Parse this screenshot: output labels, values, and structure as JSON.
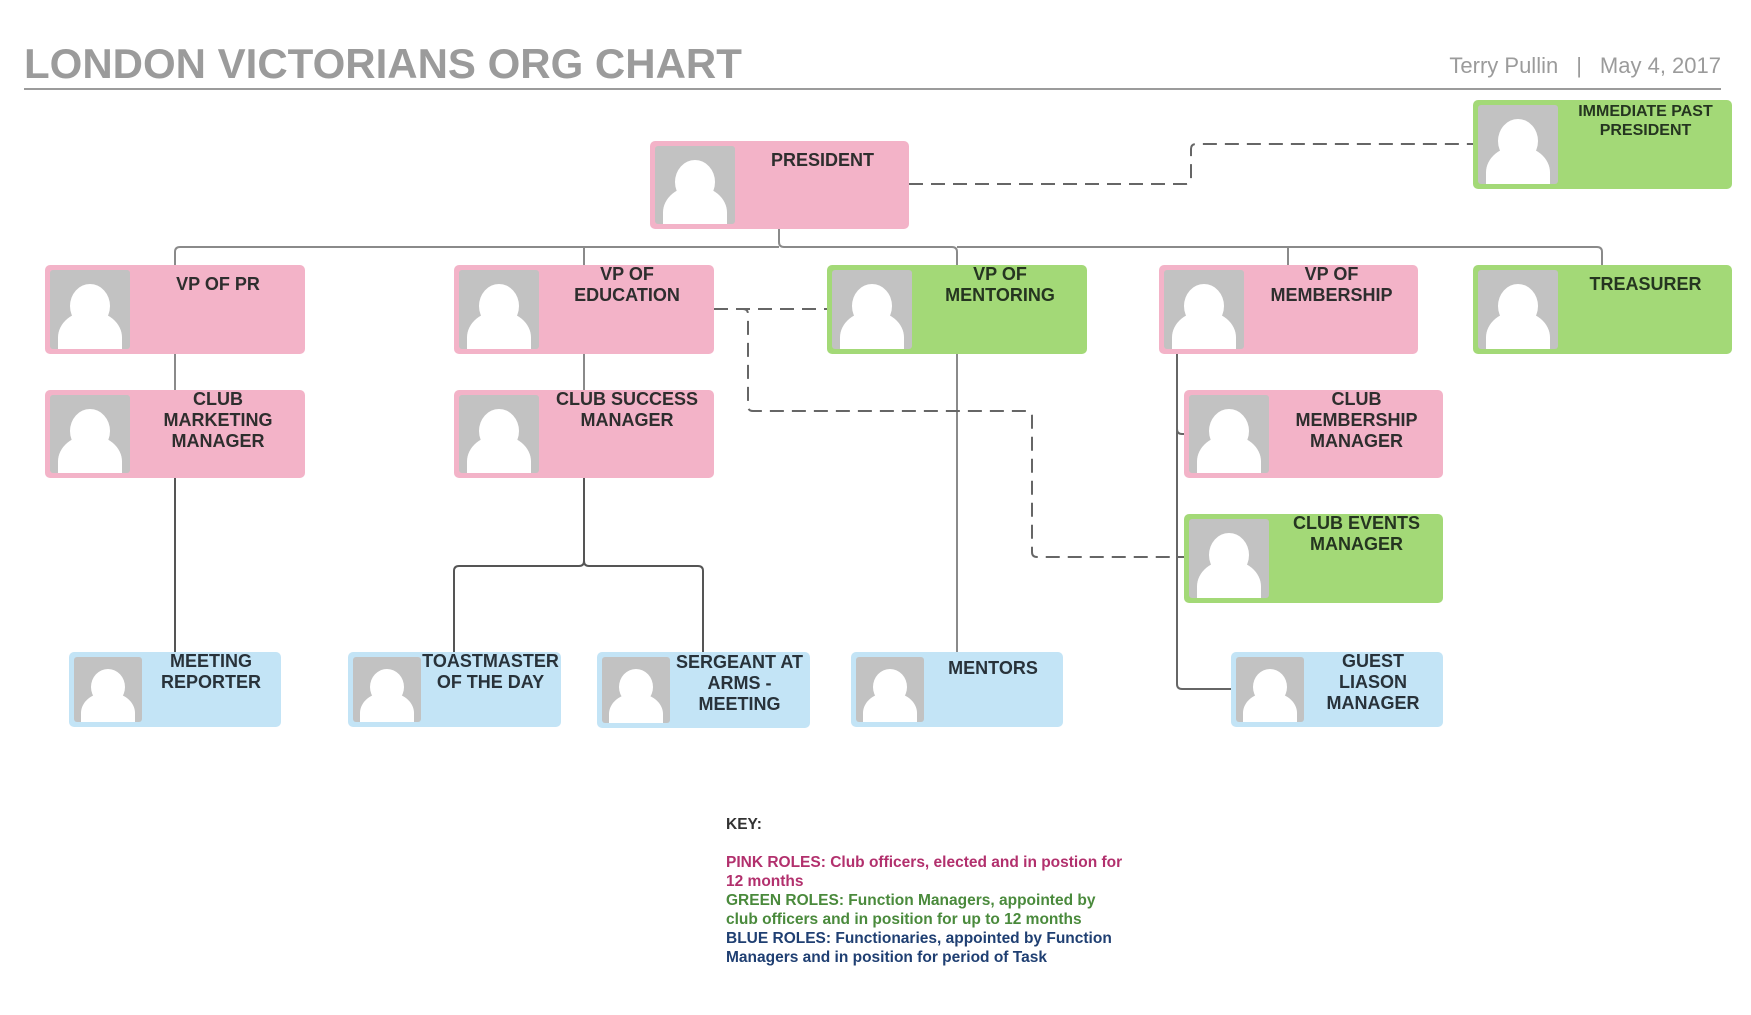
{
  "header": {
    "title": "LONDON VICTORIANS ORG CHART",
    "author": "Terry Pullin",
    "separator": "|",
    "date": "May 4, 2017"
  },
  "colors": {
    "pink": "#f3b3c8",
    "green": "#a3d977",
    "blue": "#c3e4f6",
    "photo_placeholder": "#c2c2c2",
    "connector": "#7a7a7a",
    "key_pink": "#b2306d",
    "key_green": "#4a8a3c",
    "key_blue": "#1f3f72"
  },
  "nodes": {
    "president": {
      "label": "PRESIDENT",
      "role_type": "pink",
      "icon": "person-placeholder-icon"
    },
    "immediate_past_president": {
      "label": "IMMEDIATE PAST\nPRESIDENT",
      "role_type": "green",
      "icon": "person-placeholder-icon"
    },
    "vp_pr": {
      "label": "VP OF PR",
      "role_type": "pink",
      "icon": "person-placeholder-icon"
    },
    "vp_education": {
      "label": "VP OF\nEDUCATION",
      "role_type": "pink",
      "icon": "person-placeholder-icon"
    },
    "vp_mentoring": {
      "label": "VP OF\nMENTORING",
      "role_type": "green",
      "icon": "person-placeholder-icon"
    },
    "vp_membership": {
      "label": "VP OF\nMEMBERSHIP",
      "role_type": "pink",
      "icon": "person-placeholder-icon"
    },
    "treasurer": {
      "label": "TREASURER",
      "role_type": "green",
      "icon": "person-placeholder-icon"
    },
    "club_marketing_manager": {
      "label": "CLUB\nMARKETING\nMANAGER",
      "role_type": "pink",
      "icon": "person-placeholder-icon"
    },
    "club_success_manager": {
      "label": "CLUB SUCCESS\nMANAGER",
      "role_type": "pink",
      "icon": "person-placeholder-icon"
    },
    "club_membership_manager": {
      "label": "CLUB\nMEMBERSHIP\nMANAGER",
      "role_type": "pink",
      "icon": "person-placeholder-icon"
    },
    "club_events_manager": {
      "label": "CLUB EVENTS\nMANAGER",
      "role_type": "green",
      "icon": "person-placeholder-icon"
    },
    "meeting_reporter": {
      "label": "MEETING\nREPORTER",
      "role_type": "blue",
      "icon": "person-placeholder-icon"
    },
    "toastmaster_of_the_day": {
      "label": "TOASTMASTER\nOF THE DAY",
      "role_type": "blue",
      "icon": "person-placeholder-icon"
    },
    "sergeant_at_arms": {
      "label": "SERGEANT AT\nARMS -\nMEETING",
      "role_type": "blue",
      "icon": "person-placeholder-icon"
    },
    "mentors": {
      "label": "MENTORS",
      "role_type": "blue",
      "icon": "person-placeholder-icon"
    },
    "guest_liason_manager": {
      "label": "GUEST\nLIASON\nMANAGER",
      "role_type": "blue",
      "icon": "person-placeholder-icon"
    }
  },
  "connections": [
    {
      "from": "president",
      "to": "vp_pr",
      "style": "solid"
    },
    {
      "from": "president",
      "to": "vp_education",
      "style": "solid"
    },
    {
      "from": "president",
      "to": "vp_mentoring",
      "style": "solid"
    },
    {
      "from": "president",
      "to": "vp_membership",
      "style": "solid"
    },
    {
      "from": "president",
      "to": "treasurer",
      "style": "solid"
    },
    {
      "from": "president",
      "to": "immediate_past_president",
      "style": "dashed"
    },
    {
      "from": "vp_pr",
      "to": "club_marketing_manager",
      "style": "solid"
    },
    {
      "from": "club_marketing_manager",
      "to": "meeting_reporter",
      "style": "solid"
    },
    {
      "from": "vp_education",
      "to": "club_success_manager",
      "style": "solid"
    },
    {
      "from": "club_success_manager",
      "to": "toastmaster_of_the_day",
      "style": "solid"
    },
    {
      "from": "club_success_manager",
      "to": "sergeant_at_arms",
      "style": "solid"
    },
    {
      "from": "vp_education",
      "to": "vp_mentoring",
      "style": "dashed"
    },
    {
      "from": "vp_education",
      "to": "club_events_manager",
      "style": "dashed"
    },
    {
      "from": "vp_mentoring",
      "to": "mentors",
      "style": "solid"
    },
    {
      "from": "vp_membership",
      "to": "club_membership_manager",
      "style": "solid"
    },
    {
      "from": "vp_membership",
      "to": "guest_liason_manager",
      "style": "solid"
    }
  ],
  "key": {
    "title": "KEY:",
    "pink": "PINK ROLES: Club officers, elected and in postion for 12 months",
    "green": "GREEN ROLES: Function Managers, appointed by club officers and in position for up to 12 months",
    "blue": "BLUE ROLES: Functionaries, appointed by Function Managers and in position for period of Task"
  }
}
